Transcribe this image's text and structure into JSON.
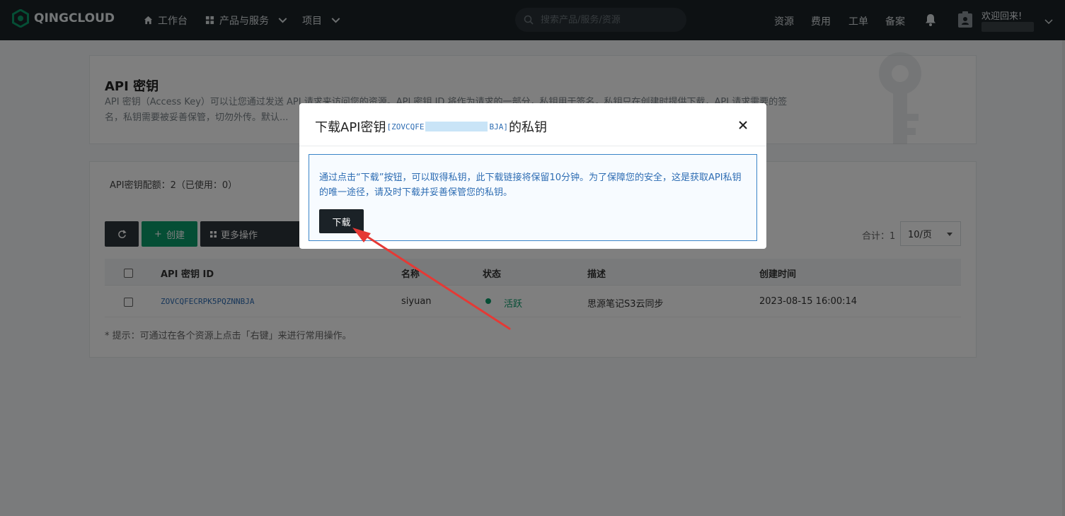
{
  "topbar": {
    "logo_text": "QINGCLOUD",
    "nav": [
      {
        "label": "工作台",
        "icon": "home-icon"
      },
      {
        "label": "产品与服务",
        "icon": "grid-icon"
      },
      {
        "label": "项目"
      }
    ],
    "search_placeholder": "搜索产品/服务/资源",
    "links": [
      "资源",
      "费用",
      "工单",
      "备案"
    ],
    "welcome": "欢迎回来!"
  },
  "page": {
    "title": "API 密钥",
    "description": "API 密钥（Access Key）可以让您通过发送 API 请求来访问您的资源。API 密钥 ID 将作为请求的一部分，私钥用于签名，私钥只在创建时提供下载，API 请求需要的签名，私钥需要被妥善保管，切勿外传。默认..."
  },
  "list": {
    "quota_label": "API密钥配额：",
    "quota_value": "2",
    "quota_used": "（已使用：0）",
    "create_label": "创建",
    "more_label": "更多操作",
    "total_label": "合计：1",
    "page_size": "10/页",
    "columns": [
      "API 密钥 ID",
      "名称",
      "状态",
      "描述",
      "创建时间"
    ],
    "rows": [
      {
        "id": "ZOVCQFECRPK5PQZNNBJA",
        "name": "siyuan",
        "status": "活跃",
        "description": "思源笔记S3云同步",
        "created": "2023-08-15 16:00:14"
      }
    ],
    "tip": "* 提示：可通过在各个资源上点击「右键」来进行常用操作。"
  },
  "modal": {
    "title_prefix": "下载API密钥",
    "key_open": "[ZOVCQFE",
    "key_close": "BJA]",
    "title_suffix": "的私钥",
    "notice": "通过点击“下载”按钮，可以取得私钥，此下载链接将保留10分钟。为了保障您的安全，这是获取API私钥的唯一途径，请及时下载并妥善保管您的私钥。",
    "download_label": "下载"
  },
  "colors": {
    "topbar": "#1b2227",
    "accent_green": "#0b9c6a",
    "notice_blue": "#2e6db3",
    "arrow_red": "#e53935"
  }
}
